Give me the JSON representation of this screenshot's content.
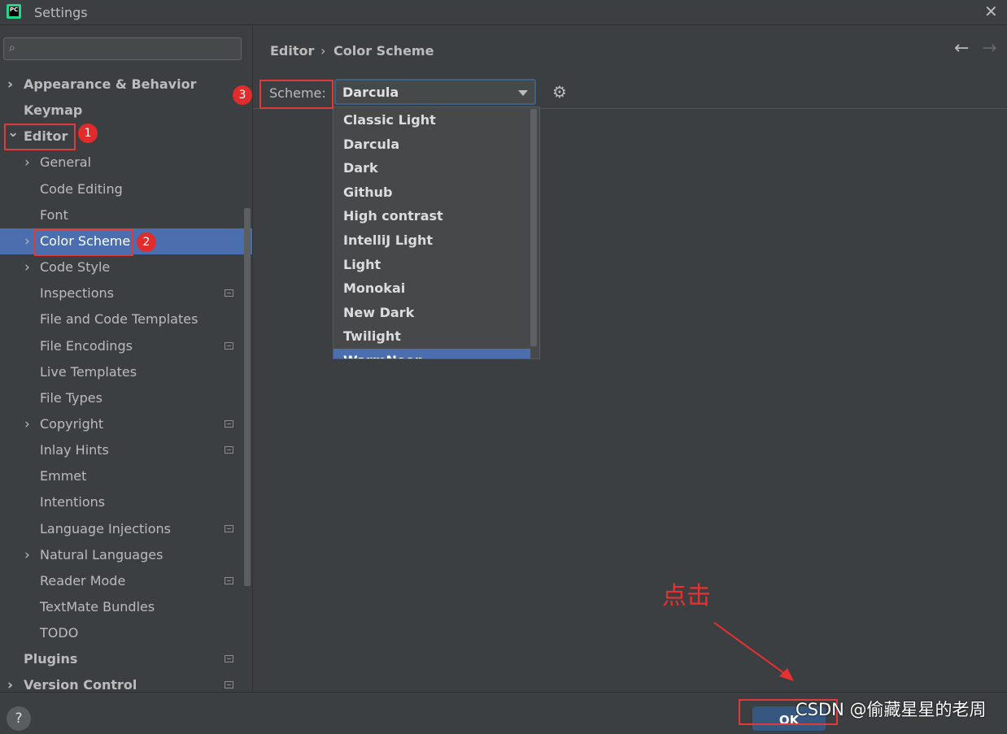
{
  "window": {
    "title": "Settings",
    "logo": "PC"
  },
  "search": {
    "placeholder": ""
  },
  "breadcrumb": [
    "Editor",
    "Color Scheme"
  ],
  "sidebar": {
    "items": [
      {
        "label": "Appearance & Behavior",
        "bold": true,
        "chevron": "›"
      },
      {
        "label": "Keymap",
        "bold": true
      },
      {
        "label": "Editor",
        "bold": true,
        "chevron": "⌄"
      },
      {
        "label": "General",
        "chevron": "›"
      },
      {
        "label": "Code Editing"
      },
      {
        "label": "Font"
      },
      {
        "label": "Color Scheme",
        "chevron": "›",
        "selected": true
      },
      {
        "label": "Code Style",
        "chevron": "›"
      },
      {
        "label": "Inspections",
        "project": true
      },
      {
        "label": "File and Code Templates"
      },
      {
        "label": "File Encodings",
        "project": true
      },
      {
        "label": "Live Templates"
      },
      {
        "label": "File Types"
      },
      {
        "label": "Copyright",
        "chevron": "›",
        "project": true
      },
      {
        "label": "Inlay Hints",
        "project": true
      },
      {
        "label": "Emmet"
      },
      {
        "label": "Intentions"
      },
      {
        "label": "Language Injections",
        "project": true
      },
      {
        "label": "Natural Languages",
        "chevron": "›"
      },
      {
        "label": "Reader Mode",
        "project": true
      },
      {
        "label": "TextMate Bundles"
      },
      {
        "label": "TODO"
      },
      {
        "label": "Plugins",
        "bold": true,
        "project": true
      },
      {
        "label": "Version Control",
        "bold": true,
        "chevron": "›",
        "project": true
      }
    ]
  },
  "scheme": {
    "label": "Scheme:",
    "value": "Darcula",
    "options": [
      "Classic Light",
      "Darcula",
      "Dark",
      "Github",
      "High contrast",
      "IntelliJ Light",
      "Light",
      "Monokai",
      "New Dark",
      "Twilight",
      "WarmNeon"
    ],
    "highlighted": "WarmNeon"
  },
  "annotations": {
    "badge1": "1",
    "badge2": "2",
    "badge3": "3",
    "click_text": "点击",
    "color": "#e03b3b"
  },
  "footer": {
    "help": "?",
    "ok": "OK"
  },
  "watermark": "CSDN @偷藏星星的老周",
  "colors": {
    "selection": "#4b6eaf",
    "background": "#3c3f41",
    "ok_button": "#365880"
  }
}
